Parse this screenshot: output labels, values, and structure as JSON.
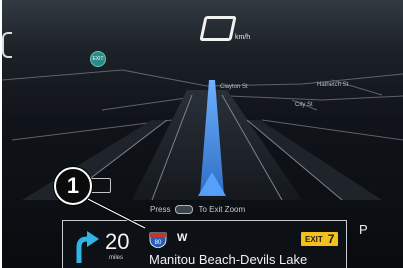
{
  "speedometer": {
    "unit": "km/h"
  },
  "map": {
    "street_labels": [
      "Clayton St",
      "Hathetch St",
      "City St"
    ],
    "poi_icon_label": "EXIT",
    "press_hint": {
      "before": "Press",
      "after": "To Exit Zoom"
    }
  },
  "guidance": {
    "distance_value": "20",
    "distance_unit": "miles",
    "highway_shield": "80",
    "direction": "W",
    "exit_label": "EXIT",
    "exit_number": "7",
    "destination": "Manitou Beach-Devils Lake"
  },
  "gear": "P",
  "callout": {
    "number": "1"
  },
  "colors": {
    "route": "#4a90d9",
    "exit_badge": "#f3c21a",
    "shield_blue": "#2a5fb8",
    "shield_red": "#c8342b",
    "turn_arrow": "#2fb6e6"
  }
}
